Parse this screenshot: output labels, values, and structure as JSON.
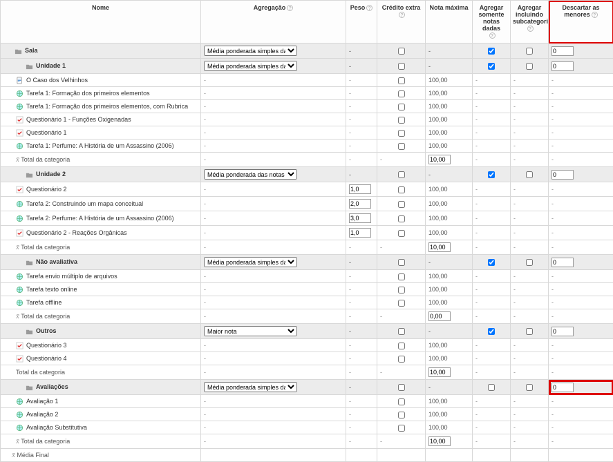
{
  "headers": {
    "name": "Nome",
    "aggregation": "Agregação",
    "weight": "Peso",
    "extra_credit": "Crédito extra",
    "max_grade": "Nota máxima",
    "agg_only_graded": "Agregar somente notas dadas",
    "agg_incl_subcat": "Agregar incluindo subcategorias",
    "drop_lowest": "Descartar as menores"
  },
  "agg_options": {
    "simple_weighted": "Média ponderada simples das notas",
    "weighted": "Média ponderada das notas",
    "highest": "Maior nota"
  },
  "final_row": "Média Final",
  "cats": {
    "sala": {
      "name": "Sala",
      "agg": "simple_weighted",
      "only": true,
      "incl": false,
      "drop": "0"
    },
    "u1": {
      "name": "Unidade 1",
      "agg": "simple_weighted",
      "only": true,
      "incl": false,
      "drop": "0",
      "items": [
        {
          "icon": "doc",
          "name": "O Caso dos Velhinhos",
          "max": "100,00"
        },
        {
          "icon": "globe",
          "name": "Tarefa 1: Formação dos primeiros elementos",
          "max": "100,00"
        },
        {
          "icon": "globe",
          "name": "Tarefa 1: Formação dos primeiros elementos, com Rubrica",
          "max": "100,00"
        },
        {
          "icon": "check",
          "name": "Questionário 1 - Funções Oxigenadas",
          "max": "100,00"
        },
        {
          "icon": "check",
          "name": "Questionário 1",
          "max": "100,00"
        },
        {
          "icon": "globe",
          "name": "Tarefa 1: Perfume: A História de um Assassino (2006)",
          "max": "100,00"
        }
      ],
      "total": "Total da categoria",
      "total_max": "10,00"
    },
    "u2": {
      "name": "Unidade 2",
      "agg": "weighted",
      "only": true,
      "incl": false,
      "drop": "0",
      "items": [
        {
          "icon": "check",
          "name": "Questionário 2",
          "peso": "1,0",
          "max": "100,00"
        },
        {
          "icon": "globe",
          "name": "Tarefa 2: Construindo um mapa conceitual",
          "peso": "2,0",
          "max": "100,00"
        },
        {
          "icon": "globe",
          "name": "Tarefa 2: Perfume: A História de um Assassino (2006)",
          "peso": "3,0",
          "max": "100,00"
        },
        {
          "icon": "check",
          "name": "Questionário 2 - Reações Orgânicas",
          "peso": "1,0",
          "max": "100,00"
        }
      ],
      "total": "Total da categoria",
      "total_max": "10,00"
    },
    "na": {
      "name": "Não avaliativa",
      "agg": "simple_weighted",
      "only": true,
      "incl": false,
      "drop": "0",
      "items": [
        {
          "icon": "globe",
          "name": "Tarefa envio múltiplo de arquivos",
          "max": "100,00"
        },
        {
          "icon": "globe",
          "name": "Tarefa texto online",
          "max": "100,00"
        },
        {
          "icon": "globe",
          "name": "Tarefa offline",
          "max": "100,00"
        }
      ],
      "total": "Total da categoria",
      "total_max": "0,00"
    },
    "out": {
      "name": "Outros",
      "agg": "highest",
      "only": true,
      "incl": false,
      "drop": "0",
      "items": [
        {
          "icon": "check",
          "name": "Questionário 3",
          "max": "100,00"
        },
        {
          "icon": "check",
          "name": "Questionário 4",
          "max": "100,00"
        }
      ],
      "total": "Total da categoria",
      "total_max": "10,00"
    },
    "av": {
      "name": "Avaliações",
      "agg": "simple_weighted",
      "only": false,
      "incl": false,
      "drop": "0",
      "items": [
        {
          "icon": "globe",
          "name": "Avaliação 1",
          "max": "100,00"
        },
        {
          "icon": "globe",
          "name": "Avaliação 2",
          "max": "100,00"
        },
        {
          "icon": "globe",
          "name": "Avaliação Substitutiva",
          "max": "100,00"
        }
      ],
      "total": "Total da categoria",
      "total_max": "10,00"
    }
  }
}
